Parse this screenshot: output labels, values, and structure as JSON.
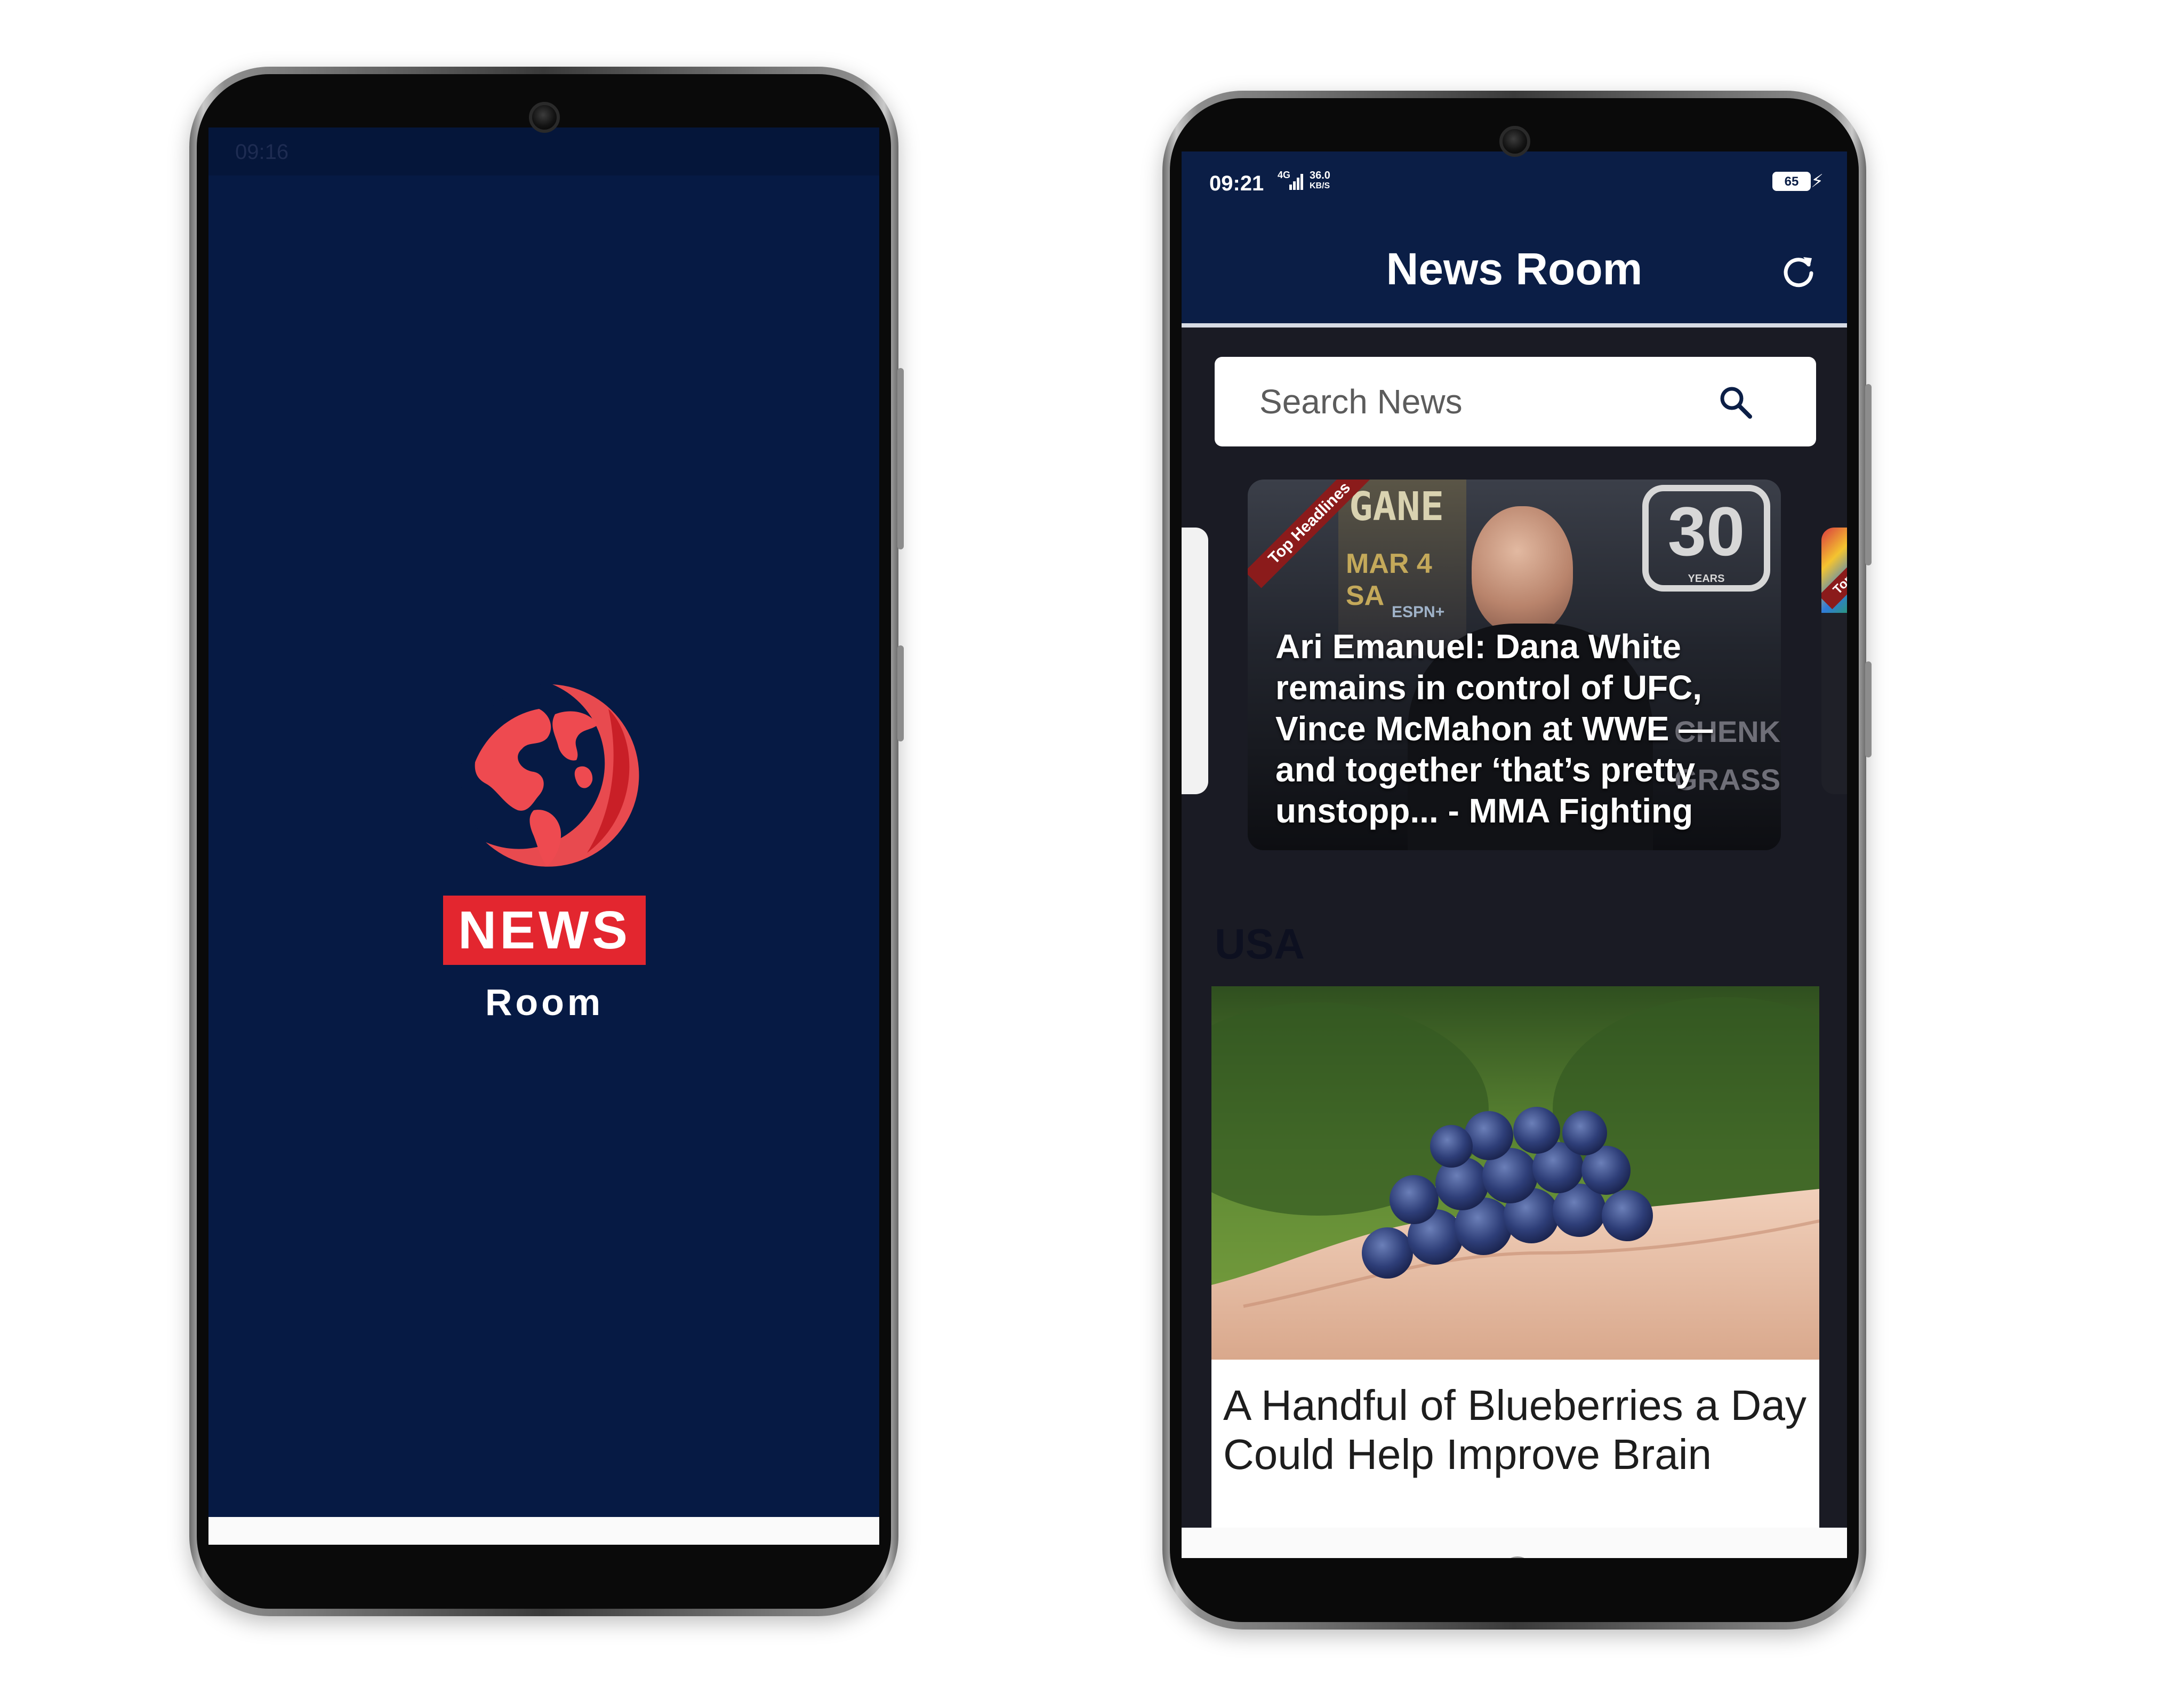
{
  "splash": {
    "status_time": "09:16",
    "logo_word": "NEWS",
    "logo_subword": "Room"
  },
  "app": {
    "status": {
      "time": "09:21",
      "network": "4G",
      "speed_value": "36.0",
      "speed_unit": "KB/S",
      "battery": "65"
    },
    "header": {
      "title": "News Room",
      "refresh_icon": "refresh-icon"
    },
    "search": {
      "placeholder": "Search News",
      "icon": "search-icon"
    },
    "carousel": {
      "ribbon_label": "Top Headlines",
      "next_ribbon_partial": "Top H",
      "items": [
        {
          "headline": "Ari Emanuel: Dana White remains in control of UFC, Vince McMahon at WWE — and together ‘that’s pretty unstopp... - MMA Fighting",
          "image_text": {
            "gane": "GANE",
            "date": "MAR 4 SA",
            "thirty": "30",
            "years": "YEARS",
            "brand": "ESPN+",
            "name": "CHENKO",
            "name2": "GRASSO"
          }
        }
      ]
    },
    "section": {
      "title": "USA"
    },
    "article": {
      "title": "A Handful of Blueberries a Day Could Help Improve Brain"
    }
  },
  "navbar": {
    "icons": [
      "recent-apps-icon",
      "home-icon",
      "back-icon"
    ]
  },
  "colors": {
    "splash_bg": "#061a44",
    "header_bg": "#0b1e46",
    "brand_red": "#e3262f",
    "feed_bg": "#1a1b24",
    "ribbon": "#8b1b1b"
  }
}
